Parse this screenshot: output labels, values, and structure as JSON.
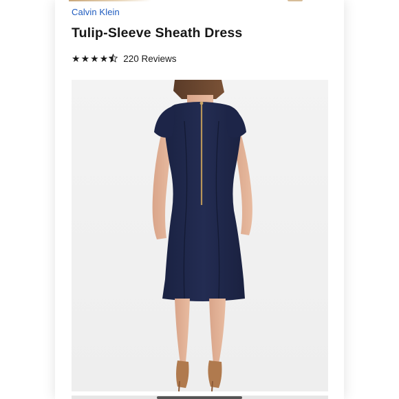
{
  "product": {
    "brand": "Calvin Klein",
    "title": "Tulip-Sleeve Sheath Dress",
    "rating": 4.5,
    "review_count_label": "220 Reviews"
  },
  "image": {
    "subject": "model-back-view-navy-dress",
    "dress_color": "#1f2848",
    "shoe_color": "#b07a4e",
    "background_color": "#f0f0f0"
  },
  "colors": {
    "brand_link": "#1e5bbf",
    "title_text": "#161616",
    "stars": "#1a1a1a"
  }
}
